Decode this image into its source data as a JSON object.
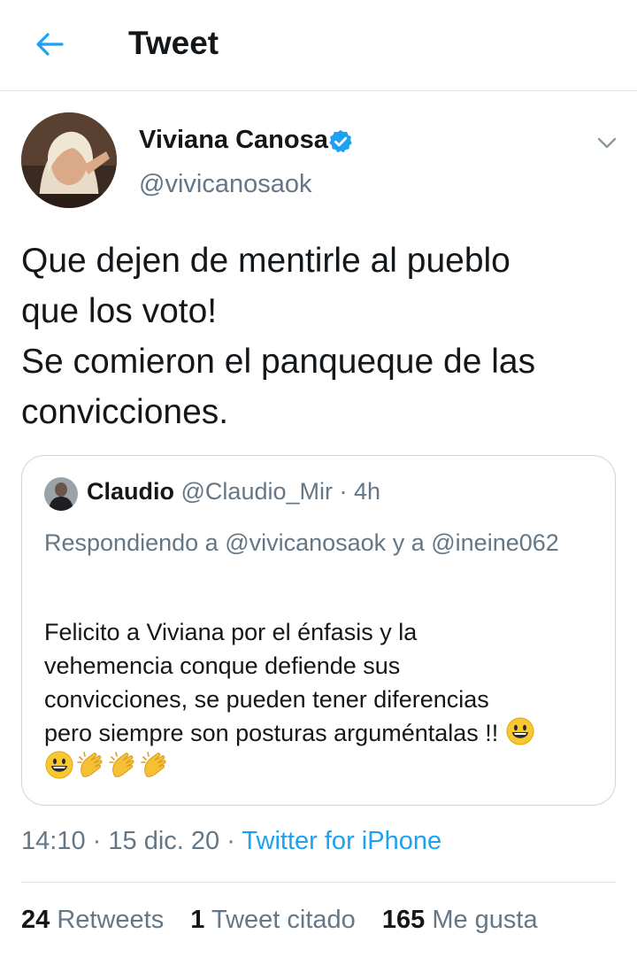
{
  "header": {
    "title": "Tweet"
  },
  "author": {
    "name": "Viviana Canosa",
    "handle": "@vivicanosaok",
    "verified": true
  },
  "tweet": {
    "lines": [
      "Que dejen de mentirle al pueblo",
      "que los voto!",
      "Se comieron el panqueque de las",
      "convicciones."
    ]
  },
  "quoted": {
    "name": "Claudio",
    "handle": "@Claudio_Mir",
    "separator": "·",
    "time": "4h",
    "reply_prefix": "Respondiendo a",
    "reply_user1": "@vivicanosaok",
    "reply_and": "y a",
    "reply_user2": "@ineine062",
    "body_lines": [
      "Felicito a Viviana por el énfasis y la",
      "vehemencia conque defiende sus",
      "convicciones, se pueden tener diferencias",
      "pero siempre son posturas arguméntalas !!"
    ],
    "emojis_line1": [
      "smiley"
    ],
    "emojis_line2": [
      "smiley",
      "clapping-hands",
      "clapping-hands",
      "clapping-hands"
    ]
  },
  "meta": {
    "time": "14:10",
    "sep1": "·",
    "date": "15 dic. 20",
    "sep2": "·",
    "source": "Twitter for iPhone"
  },
  "stats": {
    "retweets_count": "24",
    "retweets_label": "Retweets",
    "quotes_count": "1",
    "quotes_label": "Tweet citado",
    "likes_count": "165",
    "likes_label": "Me gusta"
  },
  "colors": {
    "accent": "#1da1f2",
    "text": "#14171a",
    "secondary": "#657786",
    "border": "#ccd6dd"
  },
  "icons": {
    "back": "back-arrow-icon",
    "verified": "verified-badge-icon",
    "caret": "chevron-down-icon"
  }
}
